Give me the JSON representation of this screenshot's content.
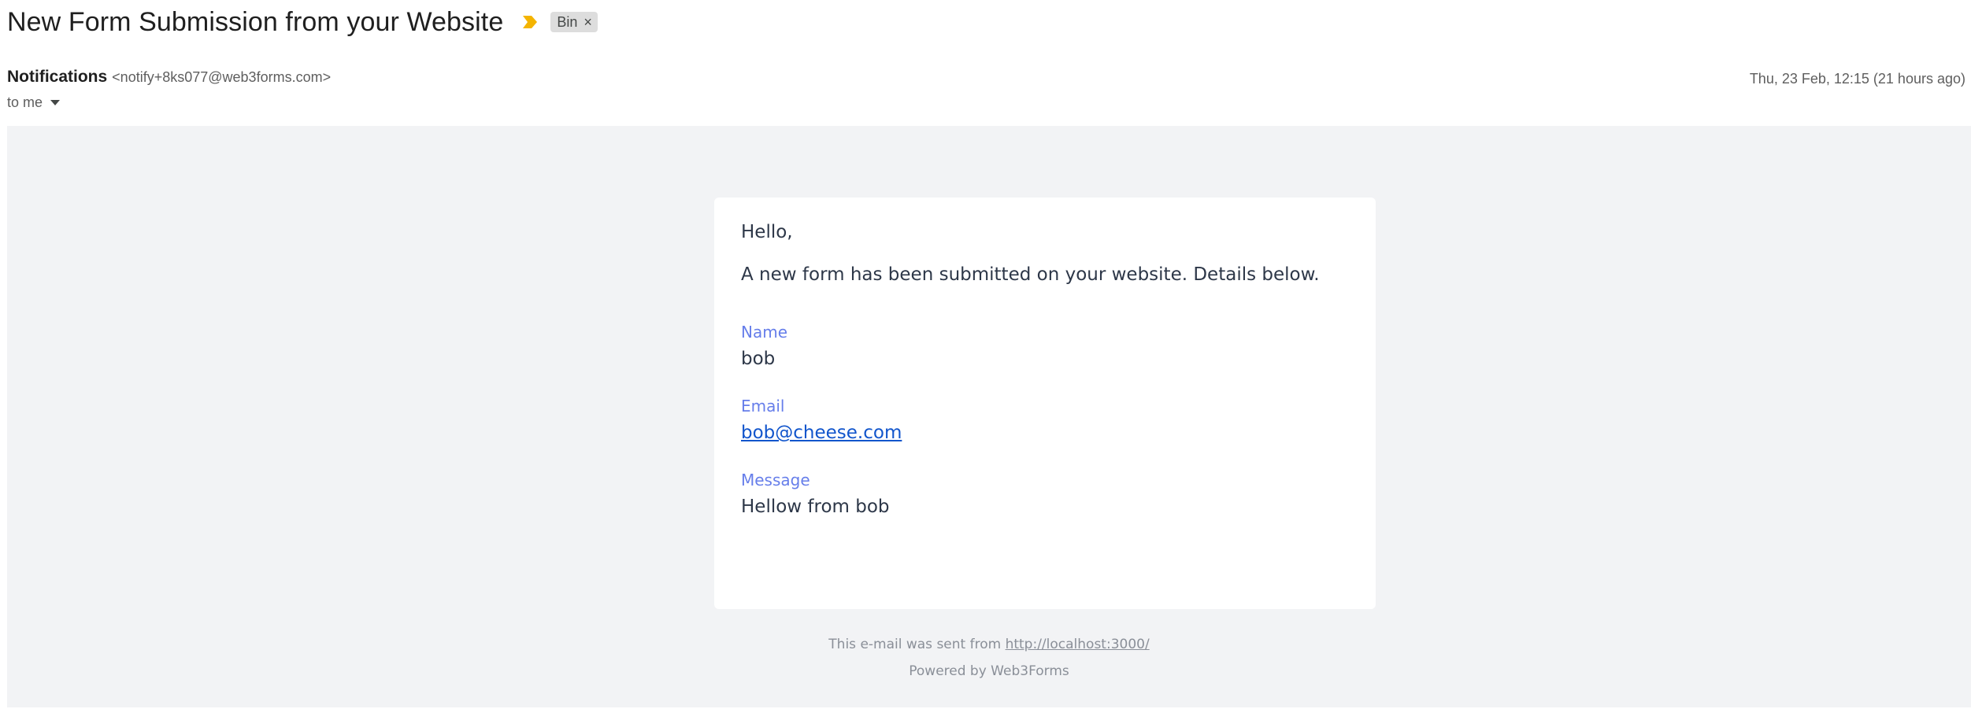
{
  "email": {
    "subject": "New Form Submission from your Website",
    "label": "Bin",
    "label_close": "×",
    "sender_name": "Notifications",
    "sender_email": "<notify+8ks077@web3forms.com>",
    "date": "Thu, 23 Feb, 12:15 (21 hours ago)",
    "recipients": "to me"
  },
  "body": {
    "greeting": "Hello,",
    "intro": "A new form has been submitted on your website. Details below.",
    "fields": [
      {
        "label": "Name",
        "value": "bob"
      },
      {
        "label": "Email",
        "value": "bob@cheese.com"
      },
      {
        "label": "Message",
        "value": "Hellow from bob"
      }
    ],
    "footer_prefix": "This e-mail was sent from ",
    "footer_link": "http://localhost:3000/",
    "powered_by": "Powered by Web3Forms"
  },
  "colors": {
    "importance_marker": "#f4b400",
    "field_label": "#667eea",
    "link": "#1155cc",
    "body_background": "#f2f3f5"
  }
}
